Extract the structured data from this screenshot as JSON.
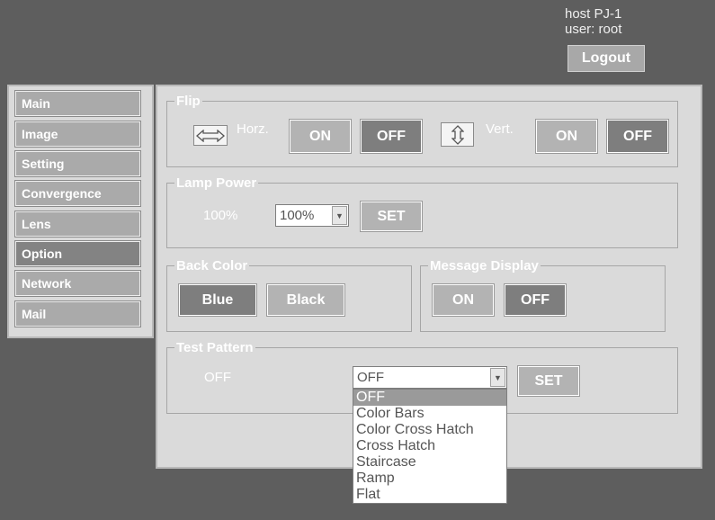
{
  "header": {
    "host": "host PJ-1",
    "user": "user: root",
    "logout_label": "Logout"
  },
  "sidebar": {
    "items": [
      {
        "label": "Main"
      },
      {
        "label": "Image"
      },
      {
        "label": "Setting"
      },
      {
        "label": "Convergence"
      },
      {
        "label": "Lens"
      },
      {
        "label": "Option",
        "active": true
      },
      {
        "label": "Network"
      },
      {
        "label": "Mail"
      }
    ]
  },
  "flip": {
    "legend": "Flip",
    "horz_label": "Horz.",
    "horz_on": "ON",
    "horz_off": "OFF",
    "horz_icon": "horizontal-arrow-icon",
    "vert_label": "Vert.",
    "vert_on": "ON",
    "vert_off": "OFF",
    "vert_icon": "vertical-arrow-icon"
  },
  "lamp_power": {
    "legend": "Lamp Power",
    "current": "100%",
    "selected": "100%",
    "set_label": "SET"
  },
  "back_color": {
    "legend": "Back Color",
    "blue": "Blue",
    "black": "Black"
  },
  "message_display": {
    "legend": "Message Display",
    "on": "ON",
    "off": "OFF"
  },
  "test_pattern": {
    "legend": "Test Pattern",
    "current": "OFF",
    "selected": "OFF",
    "set_label": "SET",
    "options": [
      "OFF",
      "Color Bars",
      "Color Cross Hatch",
      "Cross Hatch",
      "Staircase",
      "Ramp",
      "Flat"
    ]
  },
  "colors": {
    "background": "#5e5e5e",
    "panel": "#dadada",
    "button_light": "#b3b3b3",
    "button_dark": "#7e7e7e"
  }
}
